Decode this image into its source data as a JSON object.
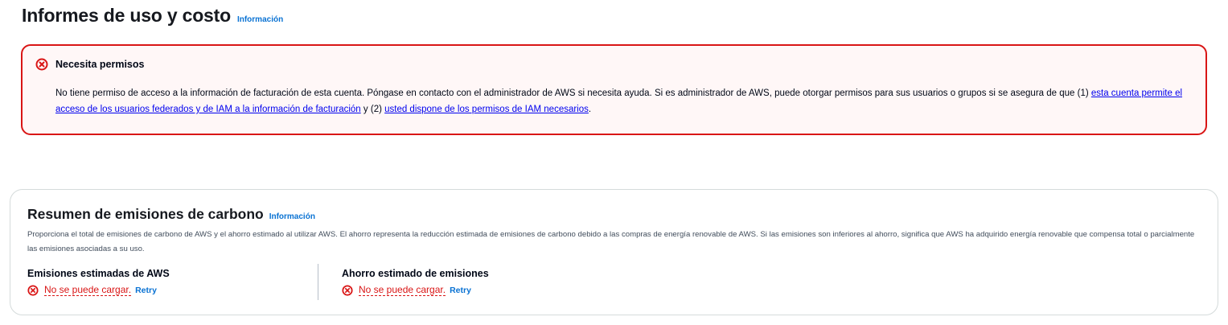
{
  "page": {
    "title": "Informes de uso y costo",
    "info_link": "Información"
  },
  "alert": {
    "icon": "error-circle-icon",
    "title": "Necesita permisos",
    "body_part1": "No tiene permiso de acceso a la información de facturación de esta cuenta. Póngase en contacto con el administrador de AWS si necesita ayuda. Si es administrador de AWS, puede otorgar permisos para sus usuarios o grupos si se asegura de que (1) ",
    "link1": "esta cuenta permite el acceso de los usuarios federados y de IAM a la información de facturación",
    "body_part2": " y (2) ",
    "link2": "usted dispone de los permisos de IAM necesarios",
    "body_part3": ".",
    "color": "#d91515"
  },
  "carbon": {
    "title": "Resumen de emisiones de carbono",
    "info_link": "Información",
    "description": "Proporciona el total de emisiones de carbono de AWS y el ahorro estimado al utilizar AWS. El ahorro representa la reducción estimada de emisiones de carbono debido a las compras de energía renovable de AWS. Si las emisiones son inferiores al ahorro, significa que AWS ha adquirido energía renovable que compensa total o parcialmente las emisiones asociadas a su uso.",
    "metrics": [
      {
        "label": "Emisiones estimadas de AWS",
        "error": "No se puede cargar.",
        "retry": "Retry"
      },
      {
        "label": "Ahorro estimado de emisiones",
        "error": "No se puede cargar.",
        "retry": "Retry"
      }
    ]
  }
}
